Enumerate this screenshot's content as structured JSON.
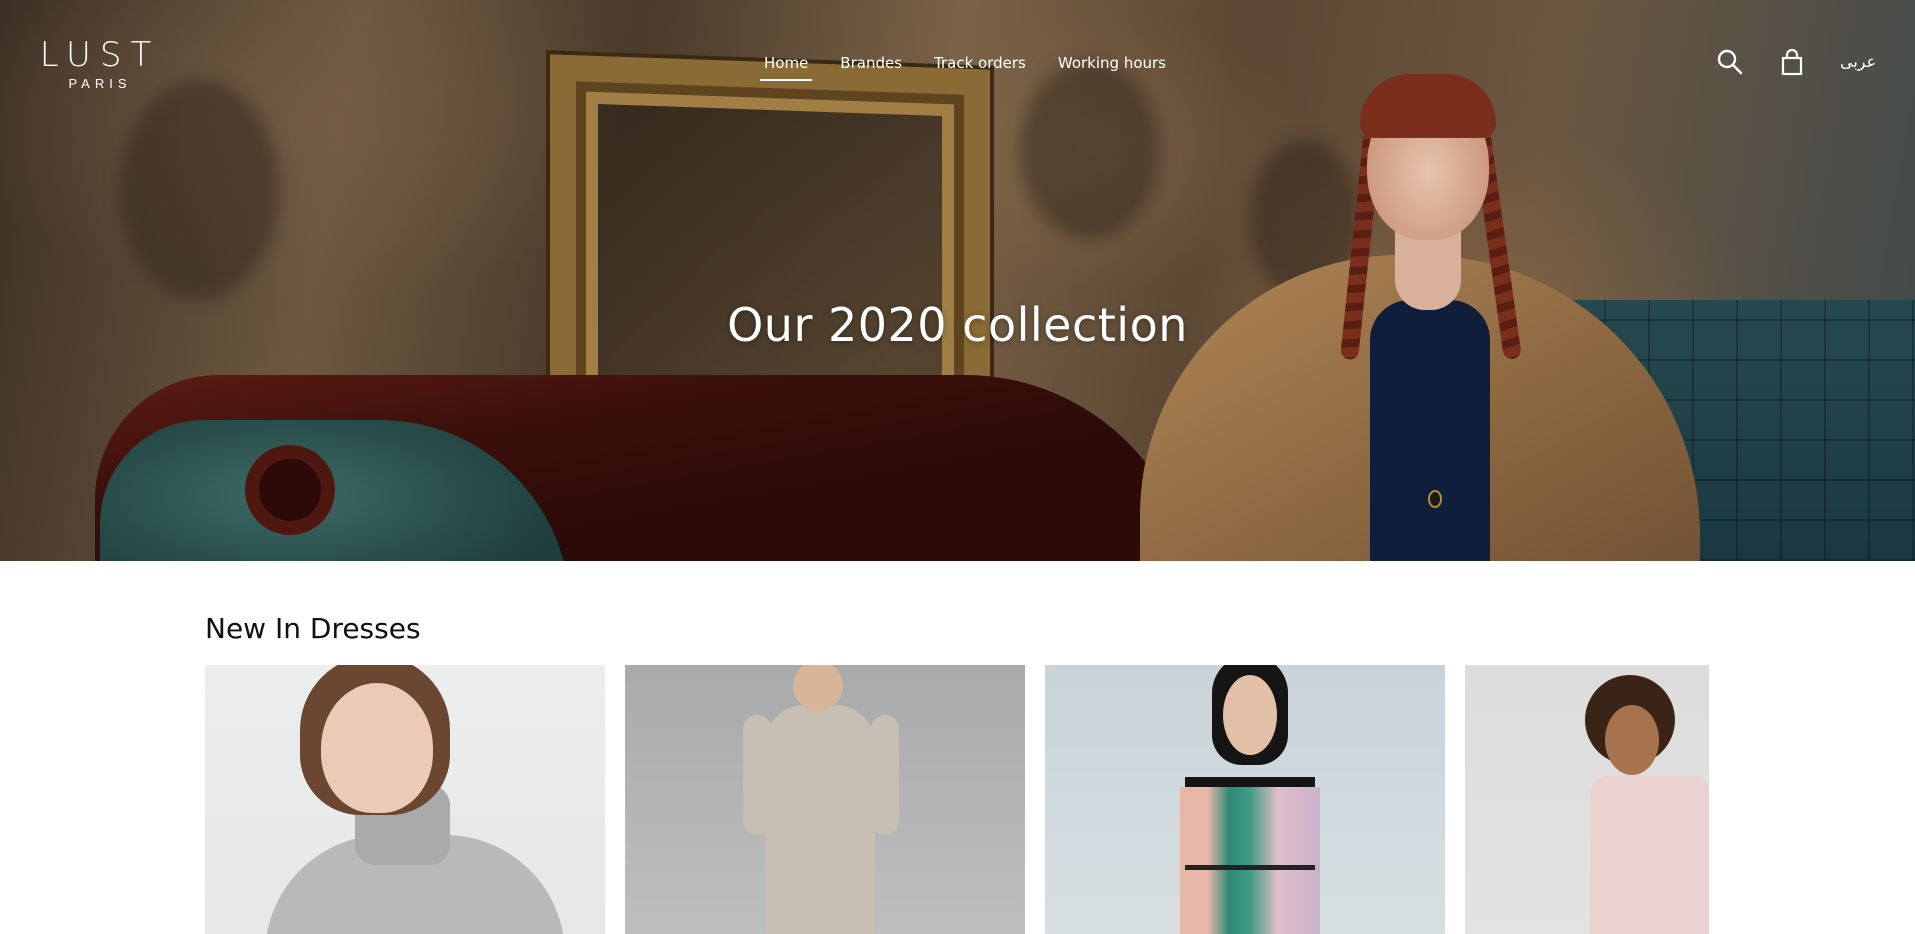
{
  "brand": {
    "name": "LUST",
    "subtitle": "PARIS"
  },
  "nav": {
    "items": [
      {
        "label": "Home",
        "active": true
      },
      {
        "label": "Brandes",
        "active": false
      },
      {
        "label": "Track orders",
        "active": false
      },
      {
        "label": "Working hours",
        "active": false
      }
    ]
  },
  "header_icons": {
    "search": "search-icon",
    "cart": "shopping-bag-icon"
  },
  "language_toggle": "عربى",
  "hero": {
    "title": "Our 2020 collection"
  },
  "section": {
    "title": "New In Dresses"
  },
  "products": [
    {
      "name": "grey-turtleneck"
    },
    {
      "name": "beige-knit-dress"
    },
    {
      "name": "pleated-off-shoulder-dress"
    },
    {
      "name": "pink-slip-dress"
    }
  ],
  "colors": {
    "hero_text": "#ffffff",
    "page_bg": "#ffffff",
    "heading": "#111111"
  }
}
